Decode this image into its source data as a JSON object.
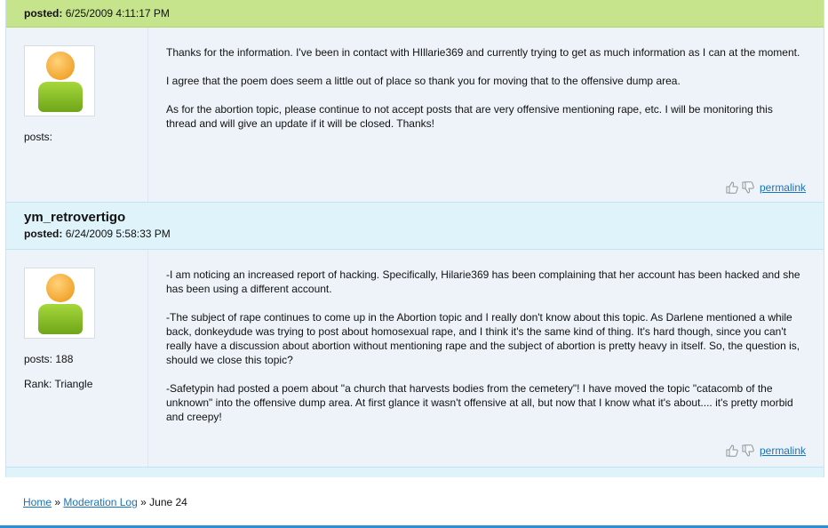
{
  "post1": {
    "posted_label": "posted:",
    "posted_value": "6/25/2009 4:11:17 PM",
    "posts_label": "posts:",
    "paragraphs": [
      "Thanks for the information. I've been in contact with HIllarie369 and currently trying to get as much information as I can at the moment.",
      "I agree that the poem does seem a little out of place so thank you for moving that to the offensive dump area.",
      "As for the abortion topic, please continue to not accept posts that are very offensive mentioning rape, etc. I will be monitoring this thread and will give an update if it will be closed. Thanks!"
    ],
    "permalink": "permalink"
  },
  "post2": {
    "username": "ym_retrovertigo",
    "posted_label": "posted:",
    "posted_value": "6/24/2009 5:58:33 PM",
    "posts_label": "posts: 188",
    "rank_label": "Rank: Triangle",
    "paragraphs": [
      "-I am noticing an increased report of hacking. Specifically, Hilarie369 has been complaining that her account has been hacked and she has been using a different account.",
      "-The subject of rape continues to come up in the Abortion topic and I really don't know about this topic. As Darlene mentioned a while back, donkeydude was trying to post about homosexual rape, and I think it's the same kind of thing. It's hard though, since you can't really have a discussion about abortion without mentioning rape and the subject of abortion is pretty heavy in itself. So, the question is, should we close this topic?",
      "-Safetypin had posted a poem about \"a church that harvests bodies from the cemetery\"! I have moved the topic \"catacomb of the unknown\" into the offensive dump area. At first glance it wasn't offensive at all, but now that I know what it's about.... it's pretty morbid and creepy!"
    ],
    "permalink": "permalink"
  },
  "breadcrumb": {
    "home": "Home",
    "sep1": "»",
    "moderation_log": "Moderation Log",
    "sep2": "»",
    "current": "June 24"
  },
  "icons": {
    "thumbs_up": "thumbs-up-icon",
    "thumbs_down": "thumbs-down-icon"
  },
  "colors": {
    "header_green": "#c6e48b",
    "header_blue": "#dff3fb",
    "link": "#1a73b8",
    "avatar_head": "#f2a630",
    "avatar_body": "#8bc22a"
  }
}
